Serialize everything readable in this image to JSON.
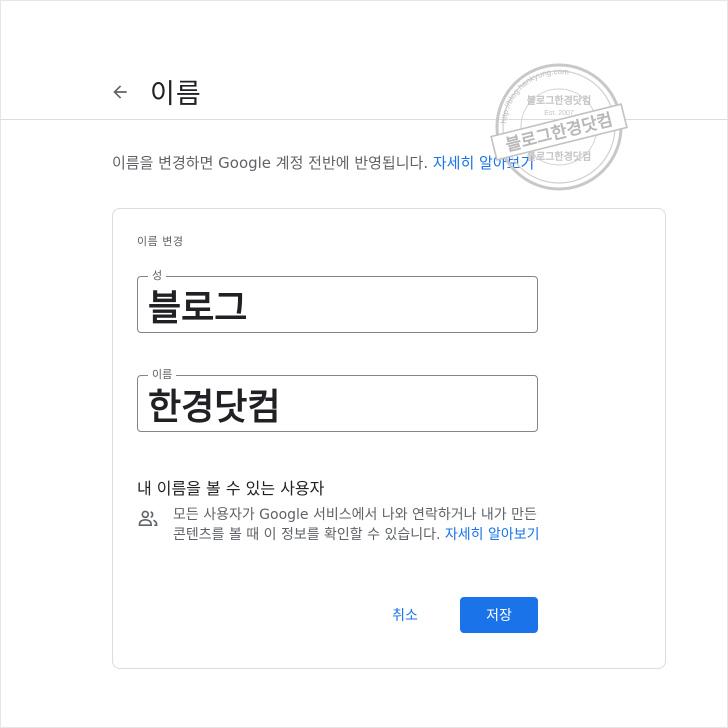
{
  "header": {
    "title": "이름",
    "back_icon": "arrow-left-icon"
  },
  "description": {
    "text": "이름을 변경하면 Google 계정 전반에 반영됩니다. ",
    "link": "자세히 알아보기"
  },
  "card": {
    "title": "이름 변경",
    "last_name": {
      "label": "성",
      "value": "블로그"
    },
    "first_name": {
      "label": "이름",
      "value": "한경닷컴"
    },
    "visibility": {
      "title": "내 이름을 볼 수 있는 사용자",
      "icon": "people-icon",
      "text": "모든 사용자가 Google 서비스에서 나와 연락하거나 내가 만든 콘텐츠를 볼 때 이 정보를 확인할 수 있습니다. ",
      "link": "자세히 알아보기"
    },
    "buttons": {
      "cancel": "취소",
      "save": "저장"
    }
  },
  "watermark": {
    "url_text": "http://blog.hankyung.com",
    "top_text": "블로그한경닷컴",
    "year_text": "Est. 2007",
    "main_text": "블로그한경닷컴",
    "bottom_text": "블로그한경닷컴"
  },
  "colors": {
    "accent": "#1a73e8",
    "text": "#202124",
    "muted": "#5f6368",
    "border": "#dadce0"
  }
}
